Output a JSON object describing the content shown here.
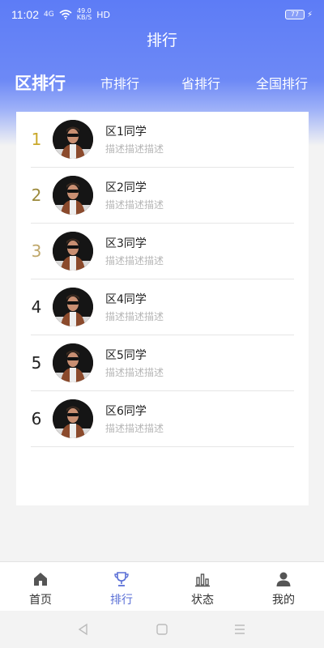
{
  "status_bar": {
    "time": "11:02",
    "signal": "4G",
    "net_speed_top": "49.0",
    "net_speed_bottom": "KB/S",
    "hd": "HD",
    "battery": "77"
  },
  "header": {
    "title": "排行"
  },
  "tabs": [
    {
      "label": "区排行",
      "active": true
    },
    {
      "label": "市排行",
      "active": false
    },
    {
      "label": "省排行",
      "active": false
    },
    {
      "label": "全国排行",
      "active": false
    }
  ],
  "ranking": [
    {
      "rank": "1",
      "name": "区1同学",
      "desc": "描述描述描述",
      "rank_color": "#c9a82a"
    },
    {
      "rank": "2",
      "name": "区2同学",
      "desc": "描述描述描述",
      "rank_color": "#9c8a3c"
    },
    {
      "rank": "3",
      "name": "区3同学",
      "desc": "描述描述描述",
      "rank_color": "#bfa76a"
    },
    {
      "rank": "4",
      "name": "区4同学",
      "desc": "描述描述描述",
      "rank_color": "#222222"
    },
    {
      "rank": "5",
      "name": "区5同学",
      "desc": "描述描述描述",
      "rank_color": "#222222"
    },
    {
      "rank": "6",
      "name": "区6同学",
      "desc": "描述描述描述",
      "rank_color": "#222222"
    }
  ],
  "tabbar": [
    {
      "label": "首页",
      "icon": "home-icon",
      "active": false
    },
    {
      "label": "排行",
      "icon": "trophy-icon",
      "active": true
    },
    {
      "label": "状态",
      "icon": "bar-chart-icon",
      "active": false
    },
    {
      "label": "我的",
      "icon": "user-icon",
      "active": false
    }
  ],
  "colors": {
    "header_gradient_top": "#5d7cf6",
    "active_tab": "#5a6fd6",
    "muted_text": "#b6b6b6"
  }
}
